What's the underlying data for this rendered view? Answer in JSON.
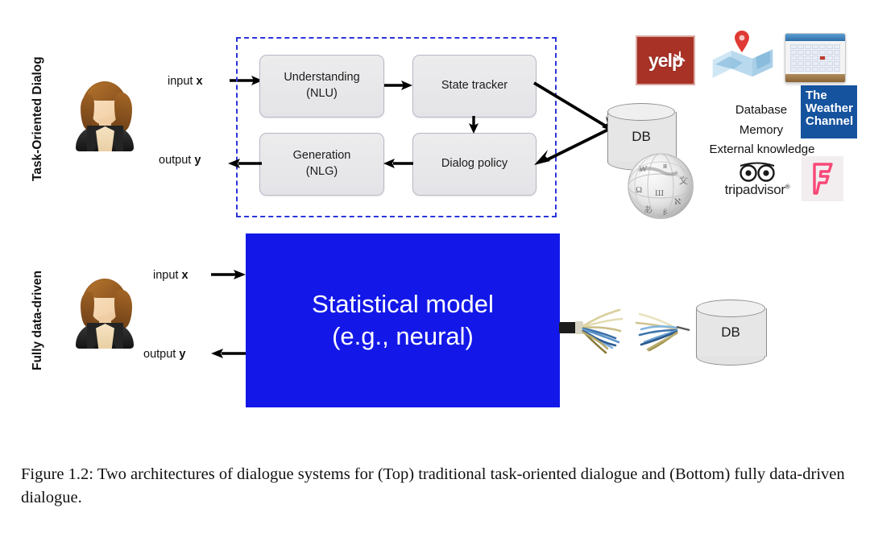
{
  "figure": {
    "caption": "Figure 1.2: Two architectures of dialogue systems for (Top) traditional task-oriented dialogue and (Bottom) fully data-driven dialogue.",
    "colors": {
      "dashed_border": "#2b35d8",
      "statistical_model_fill": "#1318e8",
      "module_fill": "#e8e8ec",
      "yelp_red": "#a93226",
      "weather_blue": "#16539e",
      "foursquare_pink": "#f94877"
    }
  },
  "top_row": {
    "row_label": "Task-Oriented Dialog",
    "user_icon": "user-avatar-icon",
    "input_label_prefix": "input ",
    "input_label_var": "x",
    "output_label_prefix": "output ",
    "output_label_var": "y",
    "modules": [
      {
        "id": "nlu",
        "line1": "Understanding",
        "line2": "(NLU)"
      },
      {
        "id": "state",
        "line1": "State tracker",
        "line2": ""
      },
      {
        "id": "policy",
        "line1": "Dialog policy",
        "line2": ""
      },
      {
        "id": "nlg",
        "line1": "Generation",
        "line2": "(NLG)"
      }
    ],
    "db_label": "DB",
    "knowledge_text": [
      "Database",
      "Memory",
      "External knowledge"
    ],
    "logos": [
      {
        "id": "yelp",
        "text": "yelp",
        "icon": "yelp-logo"
      },
      {
        "id": "maps",
        "text": "",
        "icon": "map-pin-icon"
      },
      {
        "id": "calendar",
        "text": "",
        "icon": "calendar-icon"
      },
      {
        "id": "weather",
        "text": "The\nWeather\nChannel",
        "icon": "weather-channel-logo"
      },
      {
        "id": "wikipedia",
        "text": "",
        "icon": "wikipedia-globe-icon"
      },
      {
        "id": "tripadvisor",
        "text": "tripadvisor",
        "icon": "tripadvisor-owl-logo"
      },
      {
        "id": "foursquare",
        "text": "",
        "icon": "foursquare-logo"
      }
    ],
    "weather_lines": [
      "The",
      "Weather",
      "Channel"
    ],
    "tripadvisor_mark": "®"
  },
  "bottom_row": {
    "row_label": "Fully data-driven",
    "user_icon": "user-avatar-icon",
    "input_label_prefix": "input ",
    "input_label_var": "x",
    "output_label_prefix": "output ",
    "output_label_var": "y",
    "model_line1": "Statistical model",
    "model_line2": "(e.g., neural)",
    "db_label": "DB",
    "connector_icon": "ethernet-cable-icon"
  }
}
